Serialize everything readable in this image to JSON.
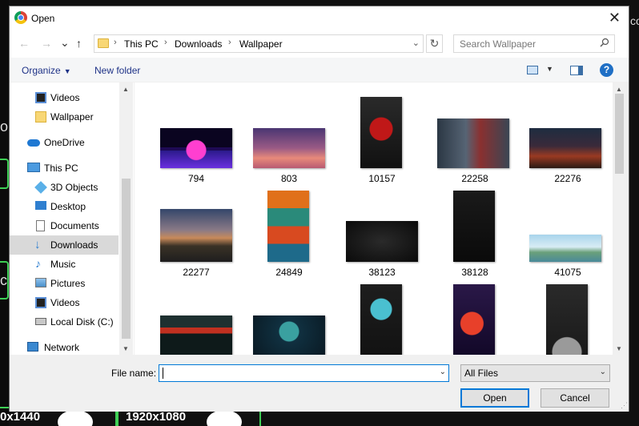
{
  "window": {
    "title": "Open"
  },
  "navigation": {
    "breadcrumbs": [
      "This PC",
      "Downloads",
      "Wallpaper"
    ],
    "search_placeholder": "Search Wallpaper"
  },
  "toolbar": {
    "organize_label": "Organize",
    "new_folder_label": "New folder",
    "help_glyph": "?"
  },
  "sidebar": {
    "items": [
      {
        "label": "Videos",
        "icon": "video-folder-icon"
      },
      {
        "label": "Wallpaper",
        "icon": "folder-icon"
      },
      {
        "label": "OneDrive",
        "icon": "cloud-icon"
      },
      {
        "label": "This PC",
        "icon": "computer-icon"
      },
      {
        "label": "3D Objects",
        "icon": "cube-icon"
      },
      {
        "label": "Desktop",
        "icon": "desktop-icon"
      },
      {
        "label": "Documents",
        "icon": "document-icon"
      },
      {
        "label": "Downloads",
        "icon": "download-icon",
        "selected": true
      },
      {
        "label": "Music",
        "icon": "music-icon"
      },
      {
        "label": "Pictures",
        "icon": "picture-icon"
      },
      {
        "label": "Videos",
        "icon": "video-folder-icon"
      },
      {
        "label": "Local Disk (C:)",
        "icon": "drive-icon"
      },
      {
        "label": "Network",
        "icon": "network-icon"
      }
    ]
  },
  "files": [
    {
      "name": "794",
      "thumb_colors": [
        "#1a0b3a",
        "#7a1fb5",
        "#e02fc7"
      ]
    },
    {
      "name": "803",
      "thumb_colors": [
        "#5a3d70",
        "#b0607e",
        "#e79382"
      ]
    },
    {
      "name": "10157",
      "thumb_colors": [
        "#1c1c1c",
        "#b02020",
        "#e8e8e8"
      ]
    },
    {
      "name": "22258",
      "thumb_colors": [
        "#2a3340",
        "#5a6878",
        "#a02828"
      ]
    },
    {
      "name": "22276",
      "thumb_colors": [
        "#1f2a3a",
        "#7a2a1a",
        "#d05a2a"
      ]
    },
    {
      "name": "22277",
      "thumb_colors": [
        "#3a4a6a",
        "#c88a5a",
        "#2a2a2a"
      ]
    },
    {
      "name": "24849",
      "thumb_colors": [
        "#e07a20",
        "#2a8a7a",
        "#c8302a"
      ]
    },
    {
      "name": "38123",
      "thumb_colors": [
        "#0e0e0e",
        "#1e1e1e",
        "#2a2a2a"
      ]
    },
    {
      "name": "38128",
      "thumb_colors": [
        "#0c0c0c",
        "#1a1a1a",
        "#242424"
      ]
    },
    {
      "name": "41075",
      "thumb_colors": [
        "#9ac8e0",
        "#5a9a6a",
        "#e8f0f4"
      ]
    },
    {
      "name": "",
      "thumb_colors": [
        "#1e2a2a",
        "#c83020",
        "#0a1a1a"
      ]
    },
    {
      "name": "",
      "thumb_colors": [
        "#0e2030",
        "#2a8a8a",
        "#103040"
      ]
    },
    {
      "name": "",
      "thumb_colors": [
        "#1a1a1a",
        "#3ab0c0",
        "#e0e0e0"
      ]
    },
    {
      "name": "",
      "thumb_colors": [
        "#2a1a4a",
        "#e0402a",
        "#3ac0d0"
      ]
    },
    {
      "name": "",
      "thumb_colors": [
        "#202020",
        "#3a3a3a",
        "#9a9a9a"
      ]
    }
  ],
  "footer": {
    "filename_label": "File name:",
    "filename_value": "",
    "filetype_value": "All Files",
    "open_label": "Open",
    "cancel_label": "Cancel"
  },
  "background": {
    "res_left": "0x1440",
    "res_right": "1920x1080",
    "edge_letter_1": "o",
    "edge_letter_2": "c",
    "edge_right": "cor"
  },
  "colors": {
    "accent": "#0078d7",
    "selected_row": "#d9d9d9",
    "link_blue": "#1e3287",
    "bg_green": "#3ecf55"
  }
}
